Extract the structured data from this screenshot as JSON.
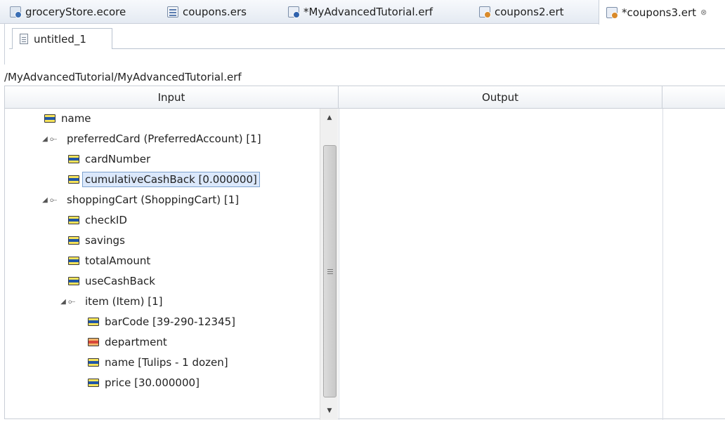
{
  "editor_tabs": [
    {
      "label": "groceryStore.ecore",
      "icon": "ecore-model-icon"
    },
    {
      "label": "coupons.ers",
      "icon": "ers-file-icon"
    },
    {
      "label": "*MyAdvancedTutorial.erf",
      "icon": "erf-file-icon"
    },
    {
      "label": "coupons2.ert",
      "icon": "ert-file-icon"
    },
    {
      "label": "*coupons3.ert",
      "icon": "ert-file-icon",
      "active": true,
      "close_glyph": "⊗"
    }
  ],
  "inner_tab": {
    "label": "untitled_1",
    "icon": "file-icon"
  },
  "path": "/MyAdvancedTutorial/MyAdvancedTutorial.erf",
  "columns": {
    "input": "Input",
    "output": "Output"
  },
  "tree": [
    {
      "label": "name",
      "type": "attribute"
    },
    {
      "label": "preferredCard (PreferredAccount) [1]",
      "type": "reference",
      "expanded": true
    },
    {
      "label": "cardNumber",
      "type": "attribute"
    },
    {
      "label": "cumulativeCashBack [0.000000]",
      "type": "attribute",
      "selected": true
    },
    {
      "label": "shoppingCart (ShoppingCart) [1]",
      "type": "reference",
      "expanded": true
    },
    {
      "label": "checkID",
      "type": "attribute"
    },
    {
      "label": "savings",
      "type": "attribute"
    },
    {
      "label": "totalAmount",
      "type": "attribute"
    },
    {
      "label": "useCashBack",
      "type": "attribute"
    },
    {
      "label": "item (Item) [1]",
      "type": "reference",
      "expanded": true
    },
    {
      "label": "barCode [39-290-12345]",
      "type": "attribute"
    },
    {
      "label": "department",
      "type": "attribute",
      "variant": "orange"
    },
    {
      "label": "name [Tulips - 1 dozen]",
      "type": "attribute"
    },
    {
      "label": "price [30.000000]",
      "type": "attribute"
    }
  ],
  "scrollbar": {
    "up_glyph": "▲",
    "down_glyph": "▼"
  }
}
